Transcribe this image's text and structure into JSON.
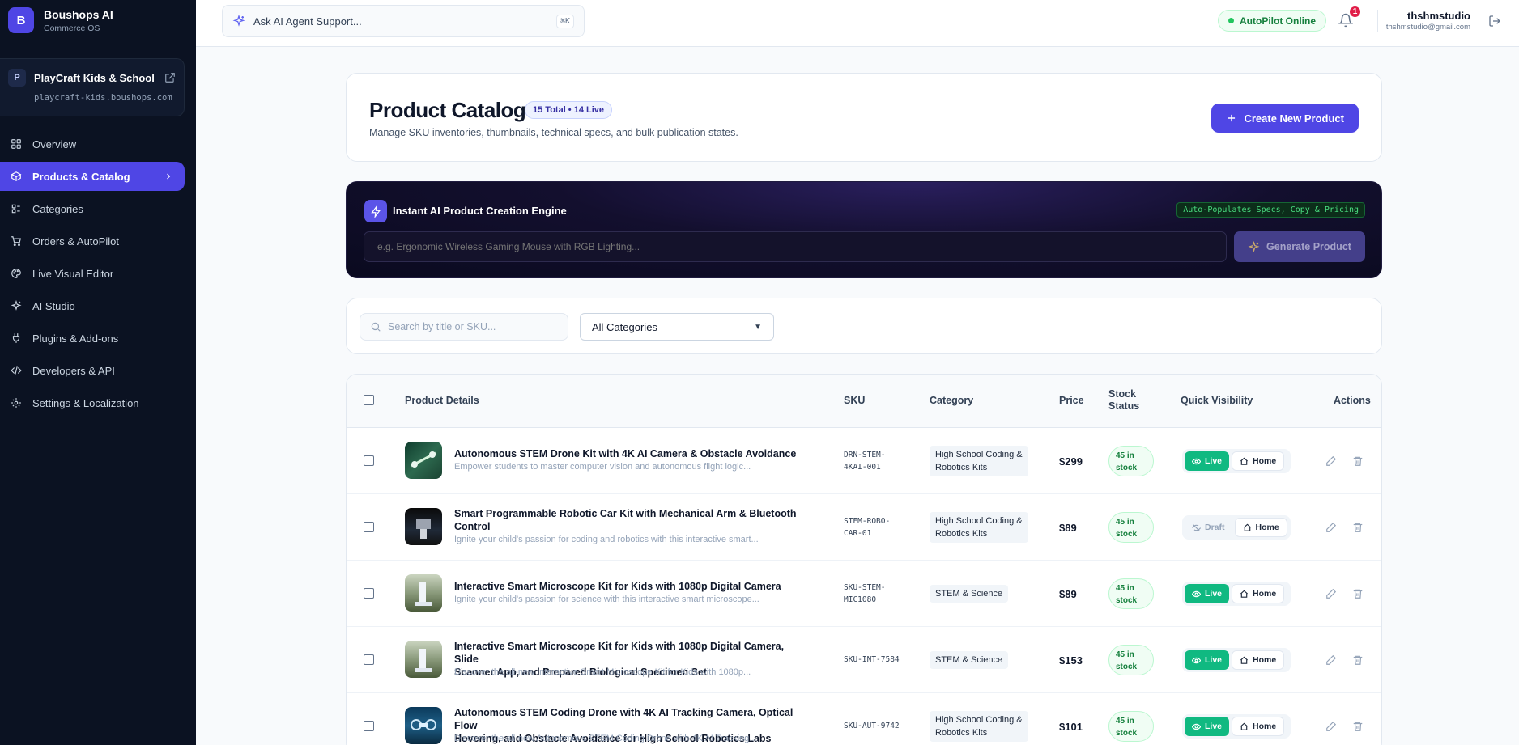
{
  "brand": {
    "logo": "B",
    "name": "Boushops AI",
    "subtitle": "Commerce OS"
  },
  "store": {
    "badge": "P",
    "name": "PlayCraft Kids & School",
    "domain": "playcraft-kids.boushops.com"
  },
  "nav": [
    {
      "label": "Overview",
      "icon": "grid-icon"
    },
    {
      "label": "Products & Catalog",
      "icon": "box-icon",
      "active": true
    },
    {
      "label": "Categories",
      "icon": "layers-icon"
    },
    {
      "label": "Orders & AutoPilot",
      "icon": "cart-icon"
    },
    {
      "label": "Live Visual Editor",
      "icon": "palette-icon"
    },
    {
      "label": "AI Studio",
      "icon": "sparkles-icon"
    },
    {
      "label": "Plugins & Add-ons",
      "icon": "plug-icon"
    },
    {
      "label": "Developers & API",
      "icon": "code-icon"
    },
    {
      "label": "Settings & Localization",
      "icon": "gear-icon"
    }
  ],
  "topbar": {
    "ask_placeholder": "Ask AI Agent Support...",
    "shortcut": "⌘K",
    "autopilot": "AutoPilot Online",
    "notifications": "1",
    "user_name": "thshmstudio",
    "user_email": "thshmstudio@gmail.com"
  },
  "header": {
    "title": "Product Catalog",
    "count_badge": "15 Total • 14 Live",
    "subtitle": "Manage SKU inventories, thumbnails, technical specs, and bulk publication states.",
    "create_label": "Create New Product"
  },
  "ai_engine": {
    "title": "Instant AI Product Creation Engine",
    "tag": "Auto-Populates Specs, Copy & Pricing",
    "placeholder": "e.g. Ergonomic Wireless Gaming Mouse with RGB Lighting...",
    "button": "Generate Product"
  },
  "filters": {
    "search_placeholder": "Search by title or SKU...",
    "category_selected": "All Categories"
  },
  "table": {
    "headers": {
      "details": "Product Details",
      "sku": "SKU",
      "category": "Category",
      "price": "Price",
      "stock_1": "Stock",
      "stock_2": "Status",
      "visibility": "Quick Visibility",
      "actions": "Actions"
    },
    "rows": [
      {
        "title_1": "Autonomous STEM Drone Kit with 4K AI Camera & Obstacle Avoidance",
        "title_2": "",
        "desc": "Empower students to master computer vision and autonomous flight logic...",
        "sku_1": "DRN-STEM-",
        "sku_2": "4KAI-001",
        "cat_1": "High School Coding &",
        "cat_2": "Robotics Kits",
        "price": "$299",
        "stock_1": "45 in",
        "stock_2": "stock",
        "status": "Live",
        "home": "Home"
      },
      {
        "title_1": "Smart Programmable Robotic Car Kit with Mechanical Arm & Bluetooth",
        "title_2": "Control",
        "desc": "Ignite your child's passion for coding and robotics with this interactive smart...",
        "sku_1": "STEM-ROBO-",
        "sku_2": "CAR-01",
        "cat_1": "High School Coding &",
        "cat_2": "Robotics Kits",
        "price": "$89",
        "stock_1": "45 in",
        "stock_2": "stock",
        "status": "Draft",
        "home": "Home"
      },
      {
        "title_1": "Interactive Smart Microscope Kit for Kids with 1080p Digital Camera",
        "title_2": "",
        "desc": "Ignite your child's passion for science with this interactive smart microscope...",
        "sku_1": "SKU-STEM-",
        "sku_2": "MIC1080",
        "cat_1": "STEM & Science",
        "cat_2": "",
        "price": "$89",
        "stock_1": "45 in",
        "stock_2": "stock",
        "status": "Live",
        "home": "Home"
      },
      {
        "title_1": "Interactive Smart Microscope Kit for Kids with 1080p Digital Camera, Slide",
        "title_2": "Scanner App, and Prepared Biological Specimen Set",
        "desc": "Discover the all-new Interactive Smart Microscope Kit for Kids with 1080p...",
        "sku_1": "SKU-INT-7584",
        "sku_2": "",
        "cat_1": "STEM & Science",
        "cat_2": "",
        "price": "$153",
        "stock_1": "45 in",
        "stock_2": "stock",
        "status": "Live",
        "home": "Home"
      },
      {
        "title_1": "Autonomous STEM Coding Drone with 4K AI Tracking Camera, Optical Flow",
        "title_2": "Hovering, and Obstacle Avoidance for High School Robotics Labs",
        "desc": "Discover the all-new Autonomous STEM Coding Drone with 4K AI Tracking...",
        "sku_1": "SKU-AUT-9742",
        "sku_2": "",
        "cat_1": "High School Coding &",
        "cat_2": "Robotics Kits",
        "price": "$101",
        "stock_1": "45 in",
        "stock_2": "stock",
        "status": "Live",
        "home": "Home"
      }
    ]
  }
}
